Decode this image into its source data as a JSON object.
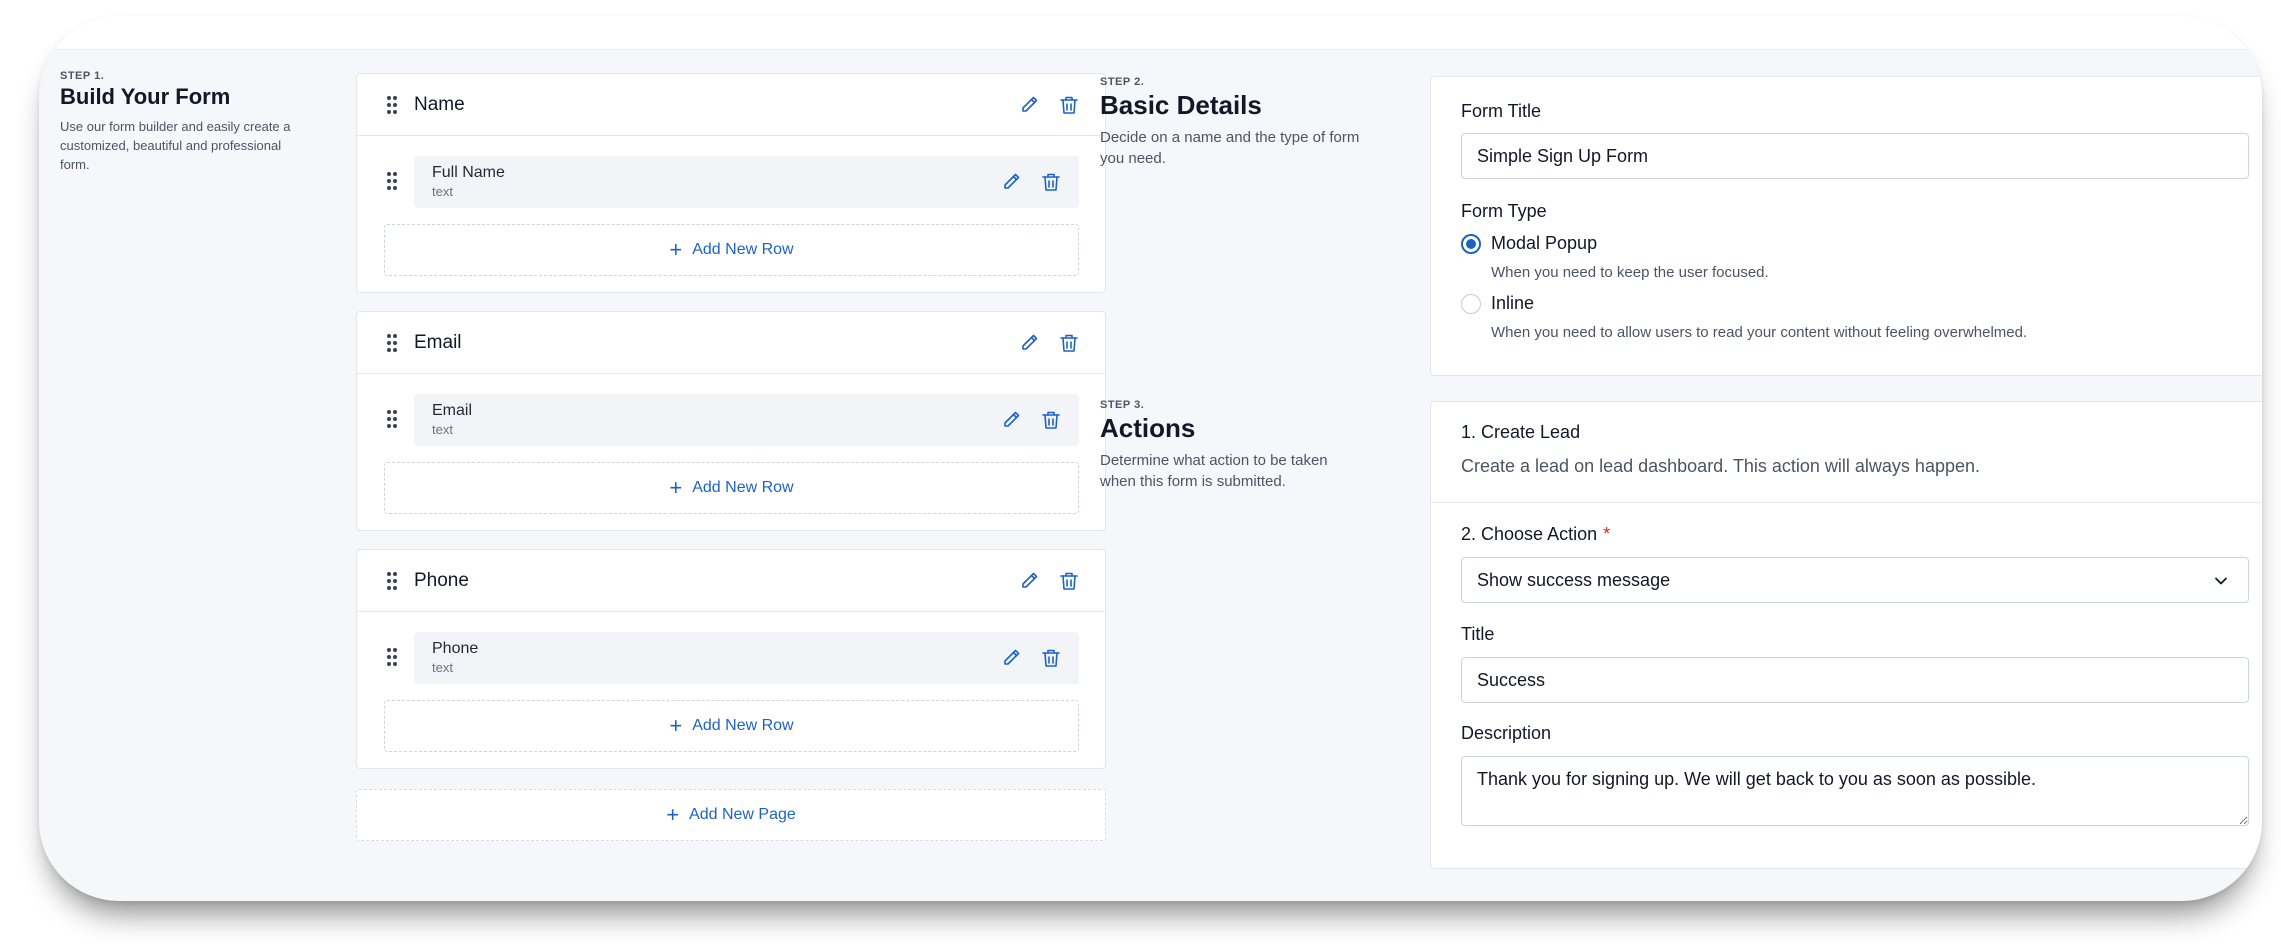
{
  "step1": {
    "kicker": "STEP 1.",
    "title": "Build Your Form",
    "description": "Use our form builder and easily create a customized, beautiful and professional form."
  },
  "builder": {
    "pages": [
      {
        "title": "Name",
        "row": {
          "label": "Full Name",
          "type": "text"
        },
        "add_row_label": "Add New Row"
      },
      {
        "title": "Email",
        "row": {
          "label": "Email",
          "type": "text"
        },
        "add_row_label": "Add New Row"
      },
      {
        "title": "Phone",
        "row": {
          "label": "Phone",
          "type": "text"
        },
        "add_row_label": "Add New Row"
      }
    ],
    "add_page_label": "Add New Page"
  },
  "step2": {
    "kicker": "STEP 2.",
    "title": "Basic Details",
    "description": "Decide on a name and the type of form you need."
  },
  "basic": {
    "form_title_label": "Form Title",
    "form_title_value": "Simple Sign Up Form",
    "form_type_label": "Form Type",
    "options": [
      {
        "label": "Modal Popup",
        "help": "When you need to keep the user focused.",
        "selected": true
      },
      {
        "label": "Inline",
        "help": "When you need to allow users to read your content without feeling overwhelmed.",
        "selected": false
      }
    ]
  },
  "step3": {
    "kicker": "STEP 3.",
    "title": "Actions",
    "description": "Determine what action to be taken when this form is submitted."
  },
  "actions": {
    "create_lead_title": "1. Create Lead",
    "create_lead_desc": "Create a lead on lead dashboard. This action will always happen.",
    "choose_action_label": "2. Choose Action",
    "required_mark": "*",
    "choose_action_value": "Show success message",
    "title_label": "Title",
    "title_value": "Success",
    "description_label": "Description",
    "description_value": "Thank you for signing up. We will get back to you as soon as possible."
  },
  "colors": {
    "accent": "#1d63c7",
    "required": "#dc2626",
    "background": "#f5f7fb"
  },
  "icons": [
    "drag-handle-icon",
    "edit-pencil-icon",
    "trash-icon",
    "plus-icon",
    "chevron-down-icon",
    "resize-handle-icon"
  ]
}
